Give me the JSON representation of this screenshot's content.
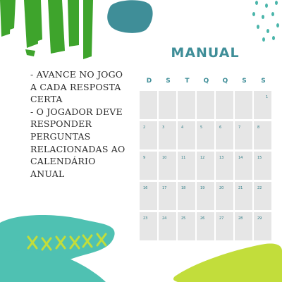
{
  "title": "MANUAL",
  "rules": [
    "- AVANCE NO JOGO",
    "A  CADA  RESPOSTA",
    "CERTA",
    "- O JOGADOR DEVE",
    "RESPONDER",
    "PERGUNTAS",
    "RELACIONADAS AO",
    "CALENDÁRIO",
    "ANUAL"
  ],
  "weekdays": [
    "D",
    "S",
    "T",
    "Q",
    "Q",
    "S",
    "S"
  ],
  "weeks": [
    [
      "",
      "",
      "",
      "",
      "",
      "",
      "1"
    ],
    [
      "2",
      "3",
      "4",
      "5",
      "6",
      "7",
      "8"
    ],
    [
      "9",
      "10",
      "11",
      "12",
      "13",
      "14",
      "15"
    ],
    [
      "16",
      "17",
      "18",
      "19",
      "20",
      "21",
      "22"
    ],
    [
      "23",
      "24",
      "25",
      "26",
      "27",
      "28",
      "29"
    ]
  ],
  "colors": {
    "green": "#3ea42c",
    "teal": "#3f8e98",
    "aqua": "#4fc1b2",
    "lime": "#c2dd3b",
    "cell": "#e6e6e6"
  }
}
